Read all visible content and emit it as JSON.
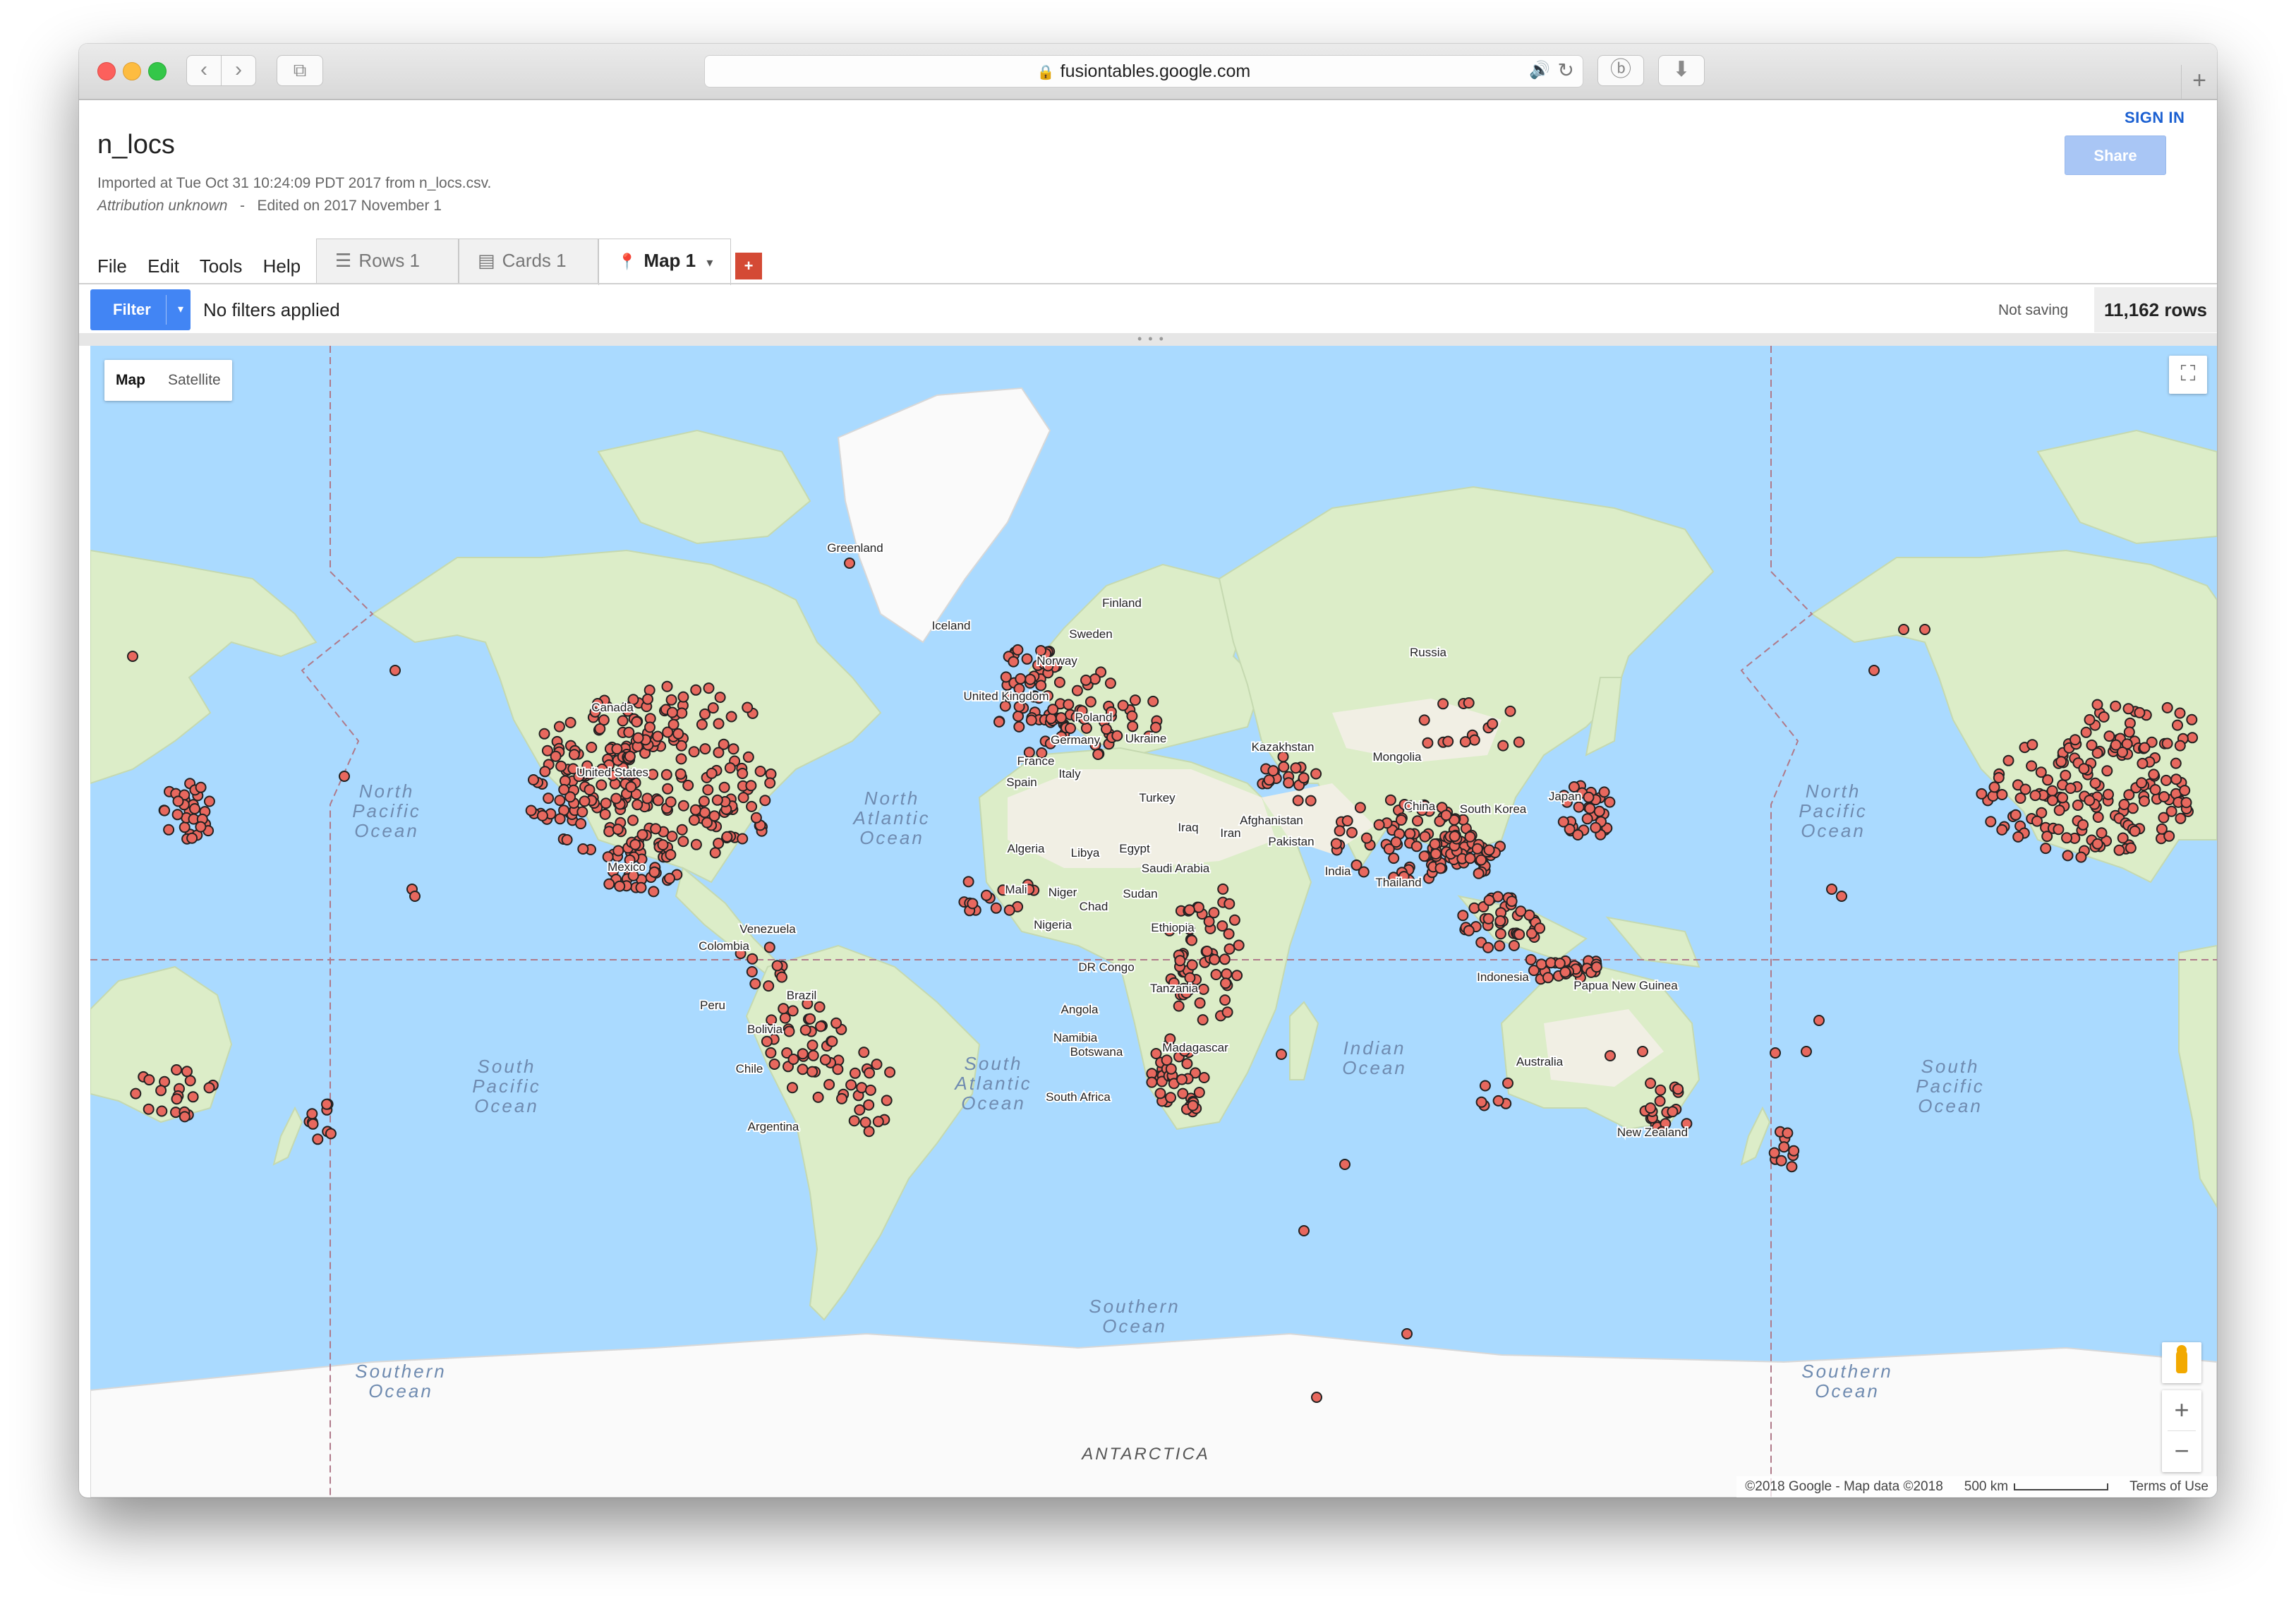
{
  "browser": {
    "url": "fusiontables.google.com",
    "back_glyph": "‹",
    "forward_glyph": "›",
    "tabs_glyph": "⧉",
    "lock_glyph": "🔒",
    "audio_glyph": "🔊",
    "reload_glyph": "↻",
    "extension_glyph": "ⓑ",
    "download_glyph": "⬇",
    "new_tab_glyph": "+",
    "icons": [
      "back-icon",
      "forward-icon",
      "tabs-icon",
      "lock-icon",
      "audio-icon",
      "reload-icon",
      "extension-icon",
      "download-icon",
      "new-tab-icon"
    ]
  },
  "header": {
    "title": "n_locs",
    "imported": "Imported at Tue Oct 31 10:24:09 PDT 2017 from n_locs.csv.",
    "attribution": "Attribution unknown",
    "separator": "-",
    "edited": "Edited on 2017 November 1",
    "sign_in": "SIGN IN",
    "share": "Share"
  },
  "menu": [
    "File",
    "Edit",
    "Tools",
    "Help"
  ],
  "tabs": [
    {
      "label": "Rows 1",
      "icon": "rows-icon",
      "glyph": "☰"
    },
    {
      "label": "Cards 1",
      "icon": "cards-icon",
      "glyph": "▤"
    },
    {
      "label": "Map 1",
      "icon": "map-pin-icon",
      "glyph": "📍",
      "active": true,
      "caret": "▾"
    }
  ],
  "add_tab": "+",
  "filter": {
    "button": "Filter",
    "caret": "▾",
    "status": "No filters applied",
    "saving": "Not saving",
    "row_count": "11,162 rows"
  },
  "map": {
    "types": [
      "Map",
      "Satellite"
    ],
    "selected_type": "Map",
    "fullscreen_glyph": "⛶",
    "zoom_in": "+",
    "zoom_out": "−",
    "footer": {
      "copyright": "©2018 Google - Map data ©2018",
      "scale": "500 km",
      "terms": "Terms of Use"
    },
    "colors": {
      "ocean": "#aadaff",
      "land": "#dcedc8",
      "desert": "#f1efe4",
      "ice": "#fafafa",
      "marker_fill": "#e8685e",
      "marker_stroke": "#222222"
    },
    "ocean_labels": [
      "North Pacific Ocean",
      "North Atlantic Ocean",
      "South Pacific Ocean",
      "South Atlantic Ocean",
      "Indian Ocean",
      "Southern Ocean",
      "ANTARCTICA"
    ],
    "country_labels": [
      "Greenland",
      "Iceland",
      "Finland",
      "Sweden",
      "Norway",
      "Russia",
      "United Kingdom",
      "Poland",
      "Ukraine",
      "Germany",
      "France",
      "Spain",
      "Italy",
      "Kazakhstan",
      "Mongolia",
      "Turkey",
      "Iraq",
      "Iran",
      "Afghanistan",
      "Pakistan",
      "China",
      "South Korea",
      "Japan",
      "Algeria",
      "Libya",
      "Egypt",
      "Saudi Arabia",
      "Mali",
      "Niger",
      "Chad",
      "Sudan",
      "Nigeria",
      "Ethiopia",
      "DR Congo",
      "Tanzania",
      "Angola",
      "Namibia",
      "Botswana",
      "Madagascar",
      "South Africa",
      "India",
      "Thailand",
      "Indonesia",
      "Papua New Guinea",
      "Australia",
      "New Zealand",
      "Canada",
      "United States",
      "Mexico",
      "Venezuela",
      "Colombia",
      "Peru",
      "Brazil",
      "Bolivia",
      "Chile",
      "Argentina"
    ]
  }
}
